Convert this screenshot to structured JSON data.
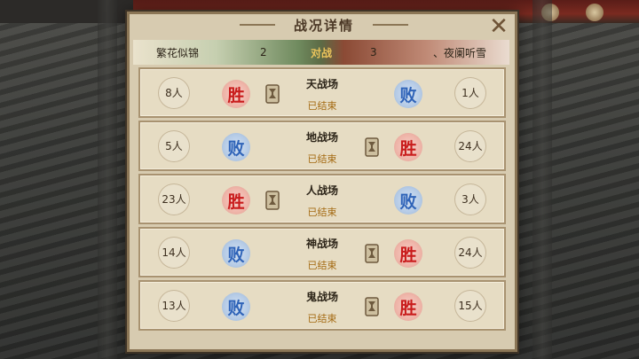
{
  "dialog": {
    "title": "战况详情",
    "close_icon": "close-icon"
  },
  "versus": {
    "left_team": "繁花似锦",
    "left_score": "2",
    "vs_label": "对战",
    "right_score": "3",
    "right_team": "、夜阑听雪"
  },
  "colors": {
    "win": "#c91c1c",
    "lose": "#2e63b8",
    "status": "#a46a12"
  },
  "rows": [
    {
      "field": "天战场",
      "status": "已结束",
      "left_count": "8人",
      "right_count": "1人",
      "left_result": "胜",
      "right_result": "败",
      "left_result_type": "win",
      "right_result_type": "lose",
      "marker_side": "left"
    },
    {
      "field": "地战场",
      "status": "已结束",
      "left_count": "5人",
      "right_count": "24人",
      "left_result": "败",
      "right_result": "胜",
      "left_result_type": "lose",
      "right_result_type": "win",
      "marker_side": "right"
    },
    {
      "field": "人战场",
      "status": "已结束",
      "left_count": "23人",
      "right_count": "3人",
      "left_result": "胜",
      "right_result": "败",
      "left_result_type": "win",
      "right_result_type": "lose",
      "marker_side": "left"
    },
    {
      "field": "神战场",
      "status": "已结束",
      "left_count": "14人",
      "right_count": "24人",
      "left_result": "败",
      "right_result": "胜",
      "left_result_type": "lose",
      "right_result_type": "win",
      "marker_side": "right"
    },
    {
      "field": "鬼战场",
      "status": "已结束",
      "left_count": "13人",
      "right_count": "15人",
      "left_result": "败",
      "right_result": "胜",
      "left_result_type": "lose",
      "right_result_type": "win",
      "marker_side": "right"
    }
  ]
}
